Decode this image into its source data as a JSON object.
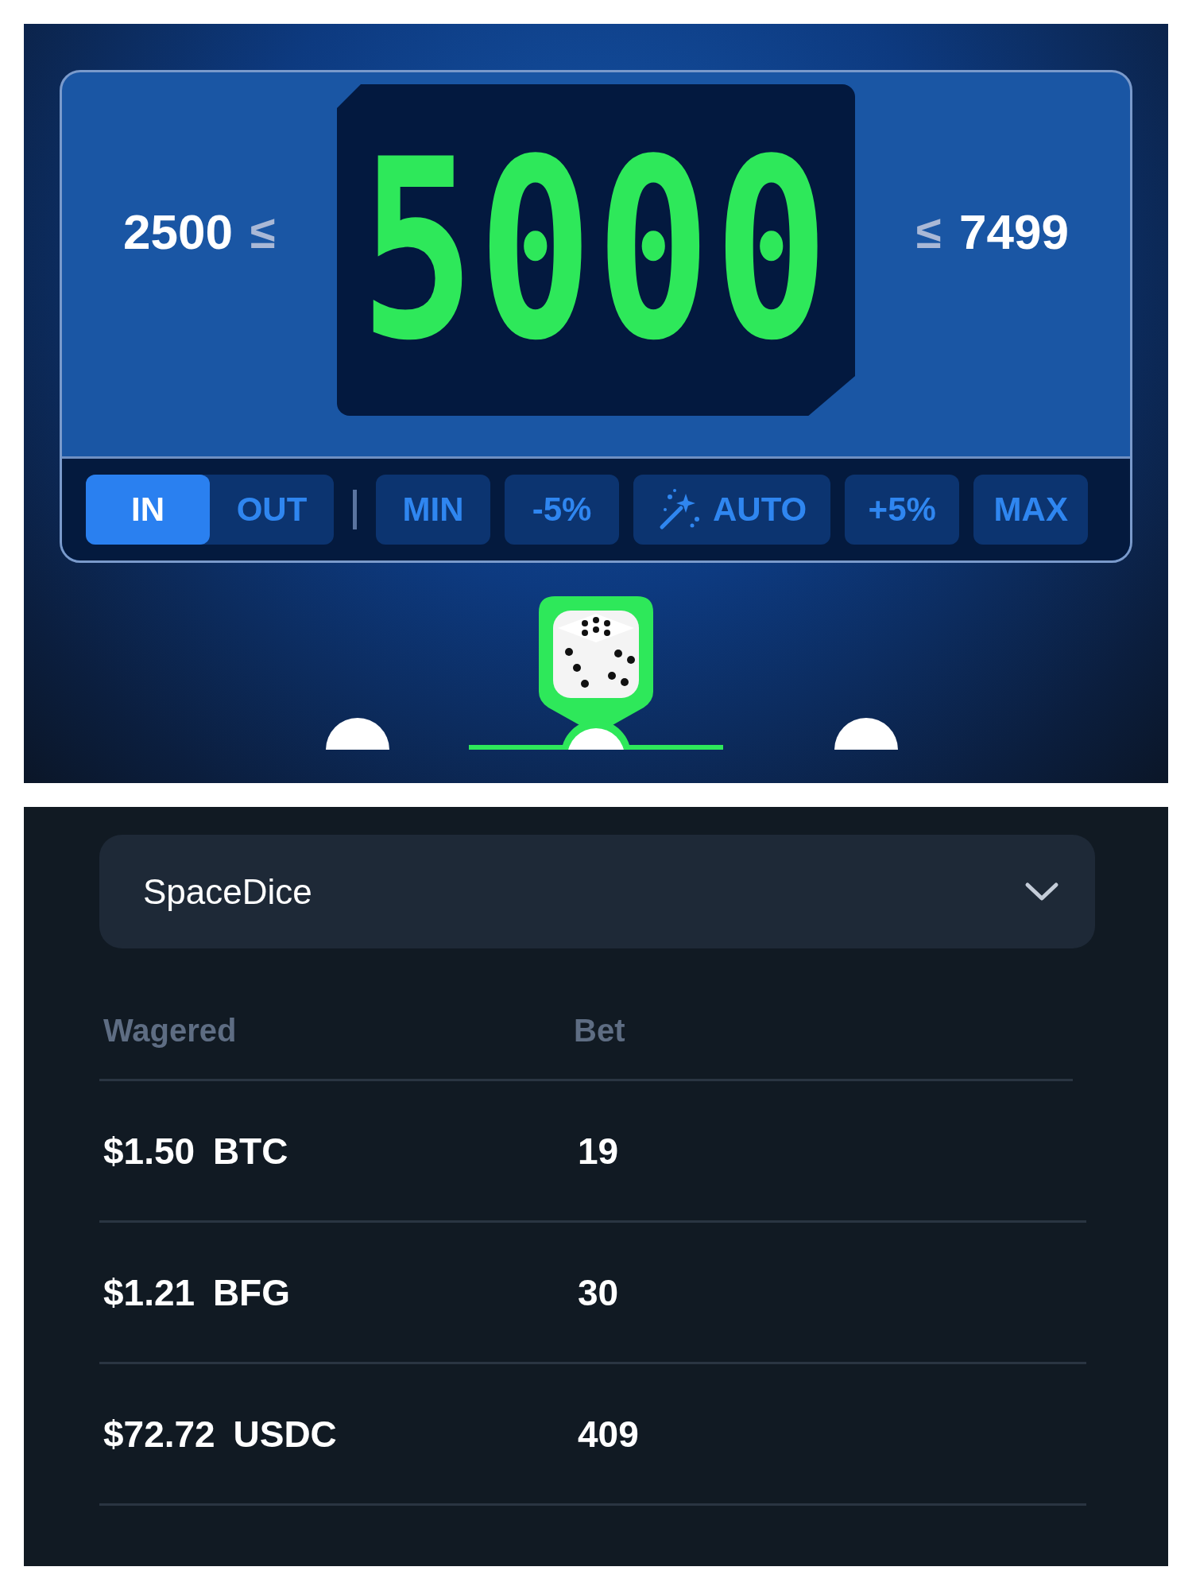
{
  "range": {
    "low": "2500",
    "low_sign": "≤",
    "high_sign": "≤",
    "high": "7499"
  },
  "display": {
    "value": "5000"
  },
  "mode_toggle": [
    {
      "label": "IN",
      "selected": true
    },
    {
      "label": "OUT",
      "selected": false
    }
  ],
  "controls": [
    {
      "label": "MIN",
      "kind": "plain"
    },
    {
      "label": "-5%",
      "kind": "plain"
    },
    {
      "label": "AUTO",
      "kind": "wand"
    },
    {
      "label": "+5%",
      "kind": "plain"
    },
    {
      "label": "MAX",
      "kind": "plain"
    }
  ],
  "game_select": {
    "value": "SpaceDice"
  },
  "table": {
    "columns": [
      "Wagered",
      "Bet"
    ],
    "rows": [
      {
        "amount": "$1.50",
        "currency": "BTC",
        "bet": "19"
      },
      {
        "amount": "$1.21",
        "currency": "BFG",
        "bet": "30"
      },
      {
        "amount": "$72.72",
        "currency": "USDC",
        "bet": "409"
      }
    ]
  }
}
